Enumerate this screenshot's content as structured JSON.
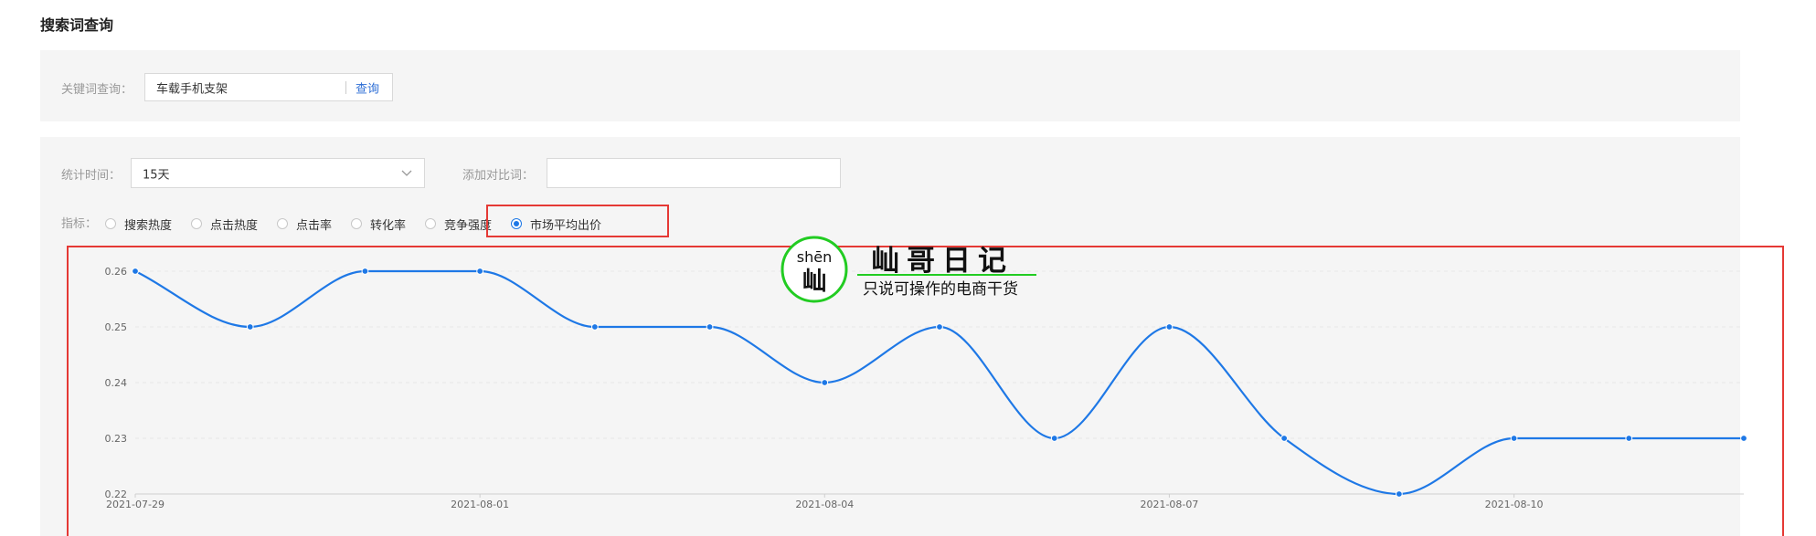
{
  "page_title": "搜索词查询",
  "keyword": {
    "label": "关键词查询：",
    "value": "车载手机支架",
    "button": "查询"
  },
  "filters": {
    "period_label": "统计时间：",
    "period_value": "15天",
    "compare_label": "添加对比词：",
    "compare_value": ""
  },
  "metrics": {
    "label": "指标：",
    "options": [
      {
        "label": "搜索热度",
        "selected": false
      },
      {
        "label": "点击热度",
        "selected": false
      },
      {
        "label": "点击率",
        "selected": false
      },
      {
        "label": "转化率",
        "selected": false
      },
      {
        "label": "竞争强度",
        "selected": false
      },
      {
        "label": "市场平均出价",
        "selected": true
      }
    ]
  },
  "watermark": {
    "pinyin": "shēn",
    "char": "屾",
    "title": "屾哥日记",
    "subtitle": "只说可操作的电商干货"
  },
  "colors": {
    "accent": "#1e78e6",
    "highlight": "#e53935",
    "watermark_ring": "#22cc22"
  },
  "chart_data": {
    "type": "line",
    "x": [
      "2021-07-29",
      "2021-07-30",
      "2021-07-31",
      "2021-08-01",
      "2021-08-02",
      "2021-08-03",
      "2021-08-04",
      "2021-08-05",
      "2021-08-06",
      "2021-08-07",
      "2021-08-08",
      "2021-08-09",
      "2021-08-10",
      "2021-08-11",
      "2021-08-12"
    ],
    "tick_labels": [
      "2021-07-29",
      "2021-08-01",
      "2021-08-04",
      "2021-08-07",
      "2021-08-10"
    ],
    "y_ticks": [
      "0.26",
      "0.25",
      "0.24",
      "0.23",
      "0.22"
    ],
    "ylim": [
      0.22,
      0.26
    ],
    "series": [
      {
        "values": [
          0.26,
          0.25,
          0.26,
          0.26,
          0.25,
          0.25,
          0.24,
          0.25,
          0.23,
          0.25,
          0.23,
          0.22,
          0.23,
          0.23,
          0.23
        ]
      }
    ],
    "grid": true
  }
}
